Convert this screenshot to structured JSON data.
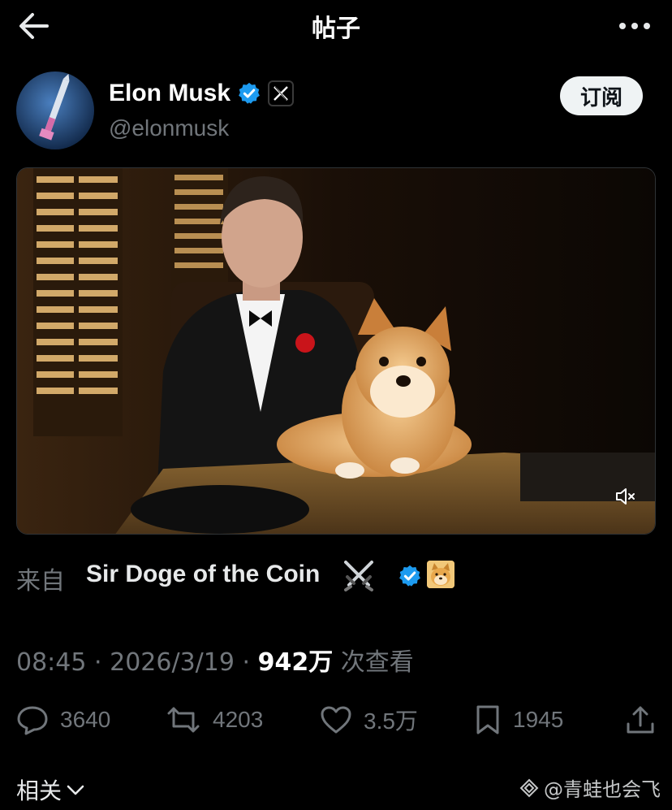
{
  "header": {
    "title": "帖子",
    "back_icon": "arrow-left-icon",
    "more_icon": "more-horizontal-icon"
  },
  "author": {
    "name": "Elon Musk",
    "handle": "@elonmusk",
    "verified_icon": "verified-badge-icon",
    "affiliation_icon": "x-logo-icon",
    "subscribe_label": "订阅"
  },
  "media": {
    "type": "video",
    "mute_icon": "volume-muted-icon"
  },
  "source": {
    "label": "来自",
    "name": "Sir Doge of the Coin",
    "emoji_icons": [
      "crossed-swords-icon",
      "doge-emoji-icon"
    ],
    "verified_icon": "verified-badge-icon"
  },
  "meta": {
    "time": "08:45",
    "separator1": "·",
    "date": "2026/3/19",
    "separator2": "·",
    "views": "942万",
    "views_label": "次查看"
  },
  "actions": {
    "replies": "3640",
    "reposts": "4203",
    "likes": "3.5万",
    "bookmarks": "1945"
  },
  "footer": {
    "related_label": "相关",
    "watermark": "@青蛙也会飞"
  },
  "colors": {
    "background": "#000000",
    "text_primary": "#e7e9ea",
    "text_secondary": "#71767b",
    "verified_blue": "#1d9bf0",
    "button_bg": "#eff3f4"
  }
}
